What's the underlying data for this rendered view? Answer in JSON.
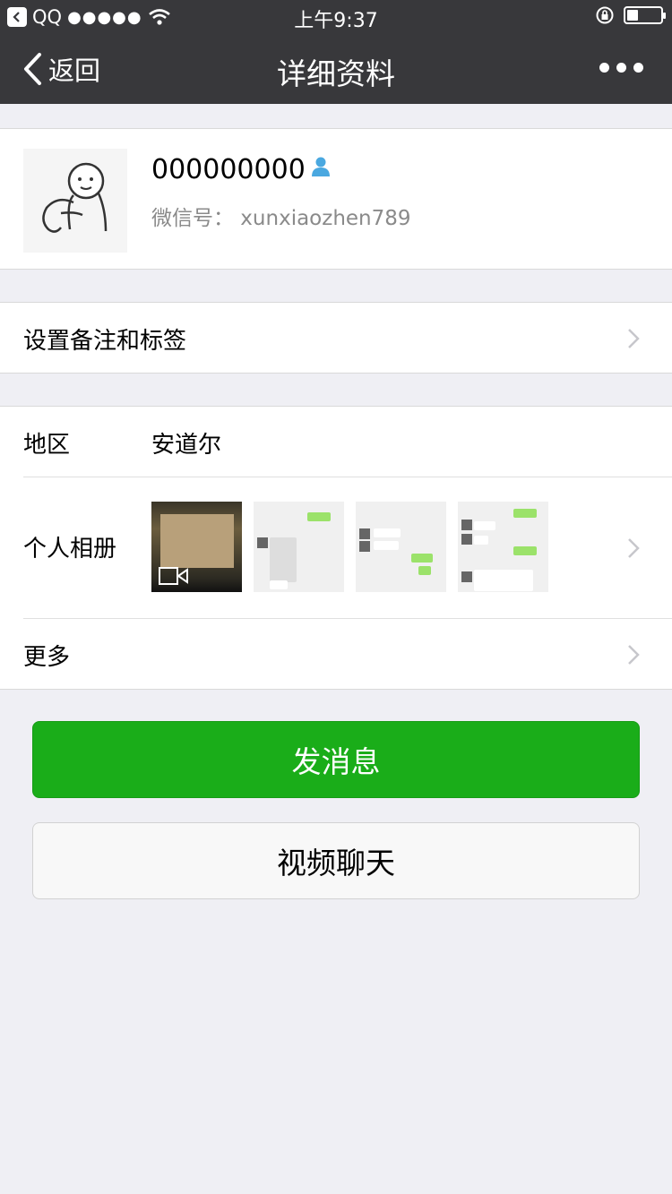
{
  "status_bar": {
    "carrier": "QQ",
    "signal": "●●●●●",
    "time": "上午9:37"
  },
  "nav": {
    "back_label": "返回",
    "title": "详细资料"
  },
  "profile": {
    "name": "000000000",
    "wechat_id": "微信号：  xunxiaozhen789"
  },
  "remarks": {
    "label": "设置备注和标签"
  },
  "info": {
    "region_label": "地区",
    "region_value": "安道尔",
    "album_label": "个人相册",
    "more_label": "更多"
  },
  "buttons": {
    "send_message": "发消息",
    "video_chat": "视频聊天"
  },
  "colors": {
    "nav_bg": "#38383b",
    "accent_green": "#1aad19",
    "page_bg": "#efeff4"
  }
}
